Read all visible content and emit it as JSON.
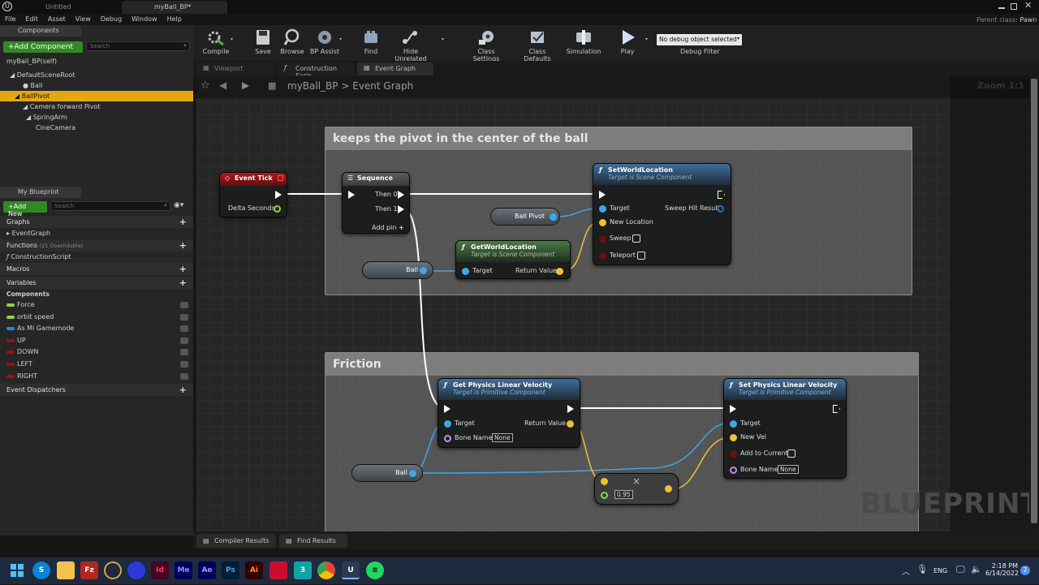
{
  "window": {
    "tabs": [
      "Untitled",
      "myBall_BP*"
    ],
    "parent_class_label": "Parent class:",
    "parent_class_value": "Pawn"
  },
  "menu": [
    "File",
    "Edit",
    "Asset",
    "View",
    "Debug",
    "Window",
    "Help"
  ],
  "components_panel": {
    "tab": "Components",
    "add_button": "+Add Component",
    "search_placeholder": "Search",
    "self_item": "myBall_BP(self)",
    "tree": [
      "DefaultSceneRoot",
      "Ball",
      "BallPivot",
      "Camera forward Pivot",
      "SpringArm",
      "CineCamera"
    ],
    "selected": "BallPivot"
  },
  "my_blueprint": {
    "tab": "My Blueprint",
    "add_new": "+Add New",
    "search_placeholder": "Search",
    "graphs_header": "Graphs",
    "graphs": [
      "EventGraph"
    ],
    "functions_header": "Functions",
    "functions_note": "(21 Overridable)",
    "functions": [
      "ConstructionScript"
    ],
    "macros_header": "Macros",
    "variables_header": "Variables",
    "components_group": "Components",
    "variables": [
      {
        "name": "Force",
        "color": "#8fd34a"
      },
      {
        "name": "orbit speed",
        "color": "#8fd34a"
      },
      {
        "name": "As Mi Gamemode",
        "color": "#2e86d8"
      },
      {
        "name": "UP",
        "color": "#9b1010"
      },
      {
        "name": "DOWN",
        "color": "#9b1010"
      },
      {
        "name": "LEFT",
        "color": "#9b1010"
      },
      {
        "name": "RIGHT",
        "color": "#9b1010"
      }
    ],
    "dispatchers_header": "Event Dispatchers"
  },
  "toolbar": {
    "compile": "Compile",
    "save": "Save",
    "browse": "Browse",
    "bp_assist": "BP Assist",
    "find": "Find",
    "hide_unrelated": "Hide Unrelated",
    "class_settings": "Class Settings",
    "class_defaults": "Class Defaults",
    "simulation": "Simulation",
    "play": "Play",
    "debug_object": "No debug object selected",
    "debug_filter": "Debug Filter"
  },
  "editor_tabs": [
    "Viewport",
    "Construction Scrip",
    "Event Graph"
  ],
  "breadcrumb": {
    "asset": "myBall_BP",
    "separator": ">",
    "graph": "Event Graph",
    "zoom": "Zoom 1:1"
  },
  "graph": {
    "comment1": "keeps the pivot in the center of the ball",
    "comment2": "Friction",
    "event_tick": {
      "title": "Event Tick",
      "pin": "Delta Seconds"
    },
    "sequence": {
      "title": "Sequence",
      "then0": "Then 0",
      "then1": "Then 1",
      "add_pin": "Add pin"
    },
    "set_world_location": {
      "title": "SetWorldLocation",
      "subtitle": "Target is Scene Component",
      "target": "Target",
      "new_location": "New Location",
      "sweep": "Sweep",
      "teleport": "Teleport",
      "sweep_hit": "Sweep Hit Result"
    },
    "get_world_location": {
      "title": "GetWorldLocation",
      "subtitle": "Target is Scene Component",
      "target": "Target",
      "return": "Return Value"
    },
    "ball_pivot_var": "Ball Pivot",
    "ball_var": "Ball",
    "get_phys_vel": {
      "title": "Get Physics Linear Velocity",
      "subtitle": "Target is Primitive Component",
      "target": "Target",
      "bone_name": "Bone Name",
      "bone_value": "None",
      "return": "Return Value"
    },
    "set_phys_vel": {
      "title": "Set Physics Linear Velocity",
      "subtitle": "Target is Primitive Component",
      "target": "Target",
      "new_vel": "New Vel",
      "add_to_current": "Add to Current",
      "bone_name": "Bone Name",
      "bone_value": "None"
    },
    "multiply_value": "0.95",
    "multiply_symbol": "×"
  },
  "watermark": "BLUEPRINT",
  "bottom_tabs": [
    "Compiler Results",
    "Find Results"
  ],
  "taskbar": {
    "apps": [
      "S",
      "Fz",
      "Id",
      "Me",
      "Ae",
      "Ps",
      "Ai",
      "3"
    ],
    "lang": "ENG",
    "time": "2:18 PM",
    "date": "6/14/2022",
    "notif_count": "2"
  }
}
